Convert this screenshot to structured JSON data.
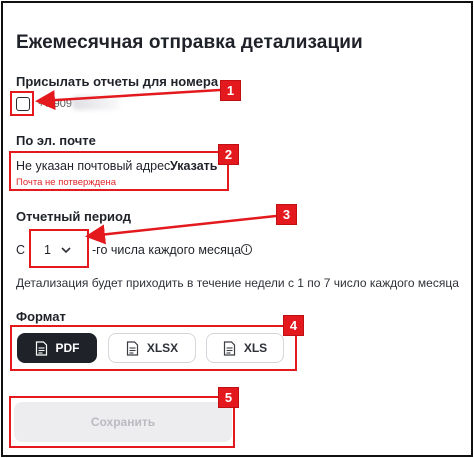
{
  "page": {
    "title": "Ежемесячная отправка детализации"
  },
  "number_section": {
    "label": "Присылать отчеты для номера",
    "phone_prefix": "+7 909",
    "checked": false
  },
  "email_section": {
    "label": "По эл. почте",
    "status_text": "Не указан почтовый адрес",
    "action_label": "Указать",
    "error_text": "Почта не потверждена"
  },
  "period_section": {
    "label": "Отчетный период",
    "from_label": "С",
    "selected_day": "1",
    "suffix": "-го числа каждого месяца",
    "info_icon": "i",
    "note": "Детализация будет приходить в течение недели с 1 по 7 число каждого месяца"
  },
  "format_section": {
    "label": "Формат",
    "options": [
      {
        "label": "PDF",
        "selected": true
      },
      {
        "label": "XLSX",
        "selected": false
      },
      {
        "label": "XLS",
        "selected": false
      }
    ]
  },
  "actions": {
    "save_label": "Сохранить",
    "save_disabled": true
  },
  "annotations": {
    "color": "#e3191d",
    "badges": [
      "1",
      "2",
      "3",
      "4",
      "5"
    ]
  },
  "colors": {
    "text": "#1f2229",
    "error": "#e0262a",
    "selected_format_bg": "#1f2229",
    "disabled_button_bg": "#ededf0"
  }
}
